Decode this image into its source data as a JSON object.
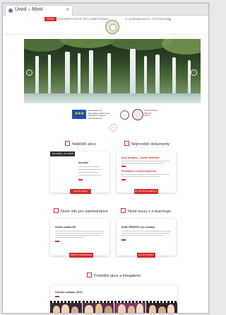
{
  "browser": {
    "tab_title": "Úvod – Most",
    "close_label": "×"
  },
  "nav": {
    "items": [
      "ÚVOD",
      "DOKUMENTY",
      "NOVÉ INFO ZAMĚSTNANCI"
    ],
    "items_right": [
      "E-LEARNING",
      "AKCE",
      "FOTOGALERIE"
    ],
    "search_label": "Q"
  },
  "hero": {
    "prev_label": "‹",
    "next_label": "›"
  },
  "partners": {
    "eu_label": "★★★",
    "eu_text_line1": "Evropská unie",
    "eu_text_line2": "Evropský sociální fond",
    "eu_text_line3": "Operační program Zaměstnanost",
    "seal_text_line1": "STATUTÁRNÍ",
    "seal_text_line2": "MĚSTO",
    "seal_text_line3": "MOST"
  },
  "scroll_down": "⌄",
  "sections": {
    "latest_events": {
      "title": "Nejbližší akce",
      "date": "21.4.2020 · 21.4.2020",
      "card_title": "Na úřadě",
      "button": "DALŠÍ AKCE"
    },
    "latest_documents": {
      "title": "Nejnovější dokumenty",
      "doc1": "Nové předpisy – úvodní informace",
      "doc2": "Prezentace k úvodní konferenci",
      "button": "DALŠÍ DOKUMENTY"
    },
    "new_employee_info": {
      "title": "Nové info pro zaměstnance",
      "card_title": "Úvodní setkání NP",
      "button": "DALŠÍ INFORMACE"
    },
    "new_elearning": {
      "title": "Nové kurzy v e-learningu",
      "card_title": "KURZ PŘEDPISY pro nováčky",
      "button": "DALŠÍ KURZY"
    },
    "gallery": {
      "title": "Poslední akce a fotogalerie",
      "card_title": "Úvodní setkání 2019"
    }
  }
}
